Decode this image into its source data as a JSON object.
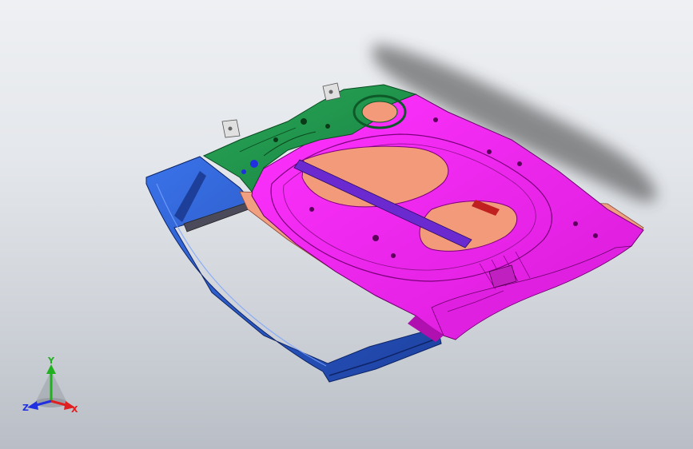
{
  "viewport": {
    "background_top": "#eef0f3",
    "background_bottom": "#b9bec6"
  },
  "model": {
    "colors": {
      "outer_panel": "#ff22ff",
      "outer_panel_dark": "#c010c0",
      "hinge_reinforcement": "#1f9a4a",
      "window_frame": "#2a5fd8",
      "window_frame_dark": "#1a3c9a",
      "inner_panel_cutout": "#f29a7a",
      "beam": "#6b2ad0",
      "bracket": "#d8d8d8"
    }
  },
  "triad": {
    "x_label": "X",
    "y_label": "Y",
    "z_label": "Z",
    "x_color": "#e02020",
    "y_color": "#20b020",
    "z_color": "#2030e0"
  }
}
